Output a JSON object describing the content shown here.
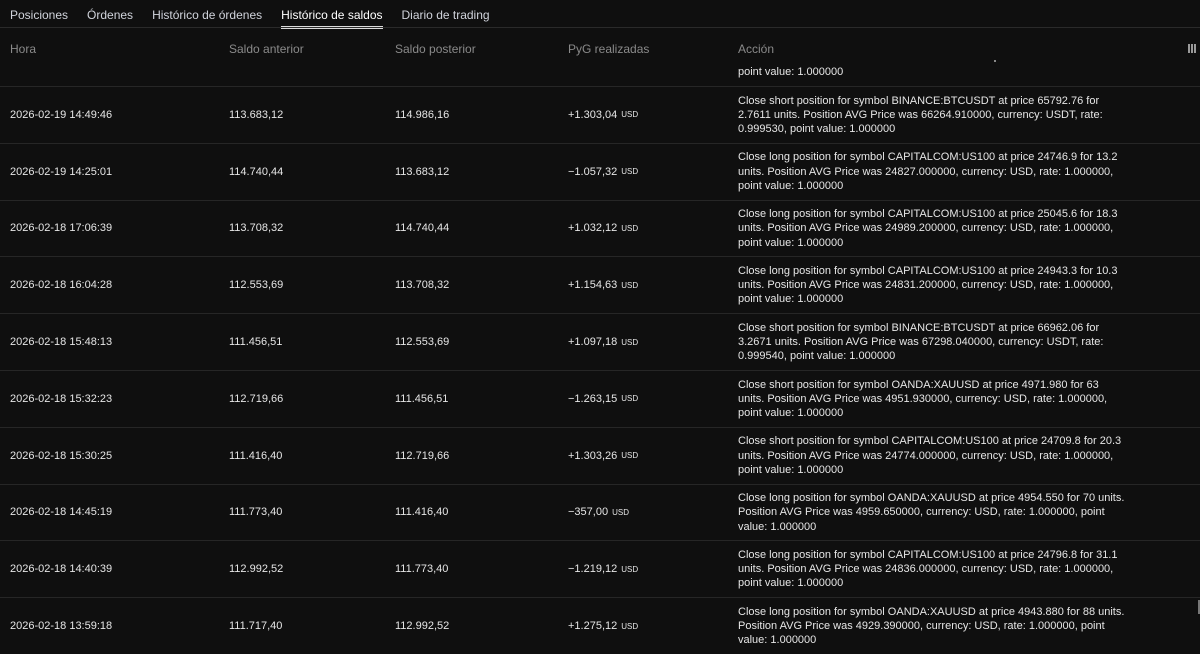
{
  "tabs": [
    {
      "label": "Posiciones"
    },
    {
      "label": "Órdenes"
    },
    {
      "label": "Histórico de órdenes"
    },
    {
      "label": "Histórico de saldos"
    },
    {
      "label": "Diario de trading"
    }
  ],
  "table": {
    "headers": {
      "hora": "Hora",
      "saldo_anterior": "Saldo anterior",
      "saldo_posterior": "Saldo posterior",
      "pyg": "PyG realizadas",
      "accion": "Acción"
    },
    "partial_text": "point value: 1.000000",
    "rows": [
      {
        "hora": "2026-02-19 14:49:46",
        "anterior": "113.683,12",
        "posterior": "114.986,16",
        "pyg": "+1.303,04",
        "unit": "USD",
        "sign": "pos",
        "accion": "Close short position for symbol BINANCE:BTCUSDT at price 65792.76 for 2.7611 units. Position AVG Price was 66264.910000, currency: USDT, rate: 0.999530, point value: 1.000000"
      },
      {
        "hora": "2026-02-19 14:25:01",
        "anterior": "114.740,44",
        "posterior": "113.683,12",
        "pyg": "−1.057,32",
        "unit": "USD",
        "sign": "neg",
        "accion": "Close long position for symbol CAPITALCOM:US100 at price 24746.9 for 13.2 units. Position AVG Price was 24827.000000, currency: USD, rate: 1.000000, point value: 1.000000"
      },
      {
        "hora": "2026-02-18 17:06:39",
        "anterior": "113.708,32",
        "posterior": "114.740,44",
        "pyg": "+1.032,12",
        "unit": "USD",
        "sign": "pos",
        "accion": "Close long position for symbol CAPITALCOM:US100 at price 25045.6 for 18.3 units. Position AVG Price was 24989.200000, currency: USD, rate: 1.000000, point value: 1.000000"
      },
      {
        "hora": "2026-02-18 16:04:28",
        "anterior": "112.553,69",
        "posterior": "113.708,32",
        "pyg": "+1.154,63",
        "unit": "USD",
        "sign": "pos",
        "accion": "Close long position for symbol CAPITALCOM:US100 at price 24943.3 for 10.3 units. Position AVG Price was 24831.200000, currency: USD, rate: 1.000000, point value: 1.000000"
      },
      {
        "hora": "2026-02-18 15:48:13",
        "anterior": "111.456,51",
        "posterior": "112.553,69",
        "pyg": "+1.097,18",
        "unit": "USD",
        "sign": "pos",
        "accion": "Close short position for symbol BINANCE:BTCUSDT at price 66962.06 for 3.2671 units. Position AVG Price was 67298.040000, currency: USDT, rate: 0.999540, point value: 1.000000"
      },
      {
        "hora": "2026-02-18 15:32:23",
        "anterior": "112.719,66",
        "posterior": "111.456,51",
        "pyg": "−1.263,15",
        "unit": "USD",
        "sign": "neg",
        "accion": "Close short position for symbol OANDA:XAUUSD at price 4971.980 for 63 units. Position AVG Price was 4951.930000, currency: USD, rate: 1.000000, point value: 1.000000"
      },
      {
        "hora": "2026-02-18 15:30:25",
        "anterior": "111.416,40",
        "posterior": "112.719,66",
        "pyg": "+1.303,26",
        "unit": "USD",
        "sign": "pos",
        "accion": "Close short position for symbol CAPITALCOM:US100 at price 24709.8 for 20.3 units. Position AVG Price was 24774.000000, currency: USD, rate: 1.000000, point value: 1.000000"
      },
      {
        "hora": "2026-02-18 14:45:19",
        "anterior": "111.773,40",
        "posterior": "111.416,40",
        "pyg": "−357,00",
        "unit": "USD",
        "sign": "neg",
        "accion": "Close long position for symbol OANDA:XAUUSD at price 4954.550 for 70 units. Position AVG Price was 4959.650000, currency: USD, rate: 1.000000, point value: 1.000000"
      },
      {
        "hora": "2026-02-18 14:40:39",
        "anterior": "112.992,52",
        "posterior": "111.773,40",
        "pyg": "−1.219,12",
        "unit": "USD",
        "sign": "neg",
        "accion": "Close long position for symbol CAPITALCOM:US100 at price 24796.8 for 31.1 units. Position AVG Price was 24836.000000, currency: USD, rate: 1.000000, point value: 1.000000"
      },
      {
        "hora": "2026-02-18 13:59:18",
        "anterior": "111.717,40",
        "posterior": "112.992,52",
        "pyg": "+1.275,12",
        "unit": "USD",
        "sign": "pos",
        "accion": "Close long position for symbol OANDA:XAUUSD at price 4943.880 for 88 units. Position AVG Price was 4929.390000, currency: USD, rate: 1.000000, point value: 1.000000"
      }
    ]
  },
  "colors": {
    "positive": "#22ab94",
    "negative": "#f23645",
    "background": "#0f0f0f"
  }
}
